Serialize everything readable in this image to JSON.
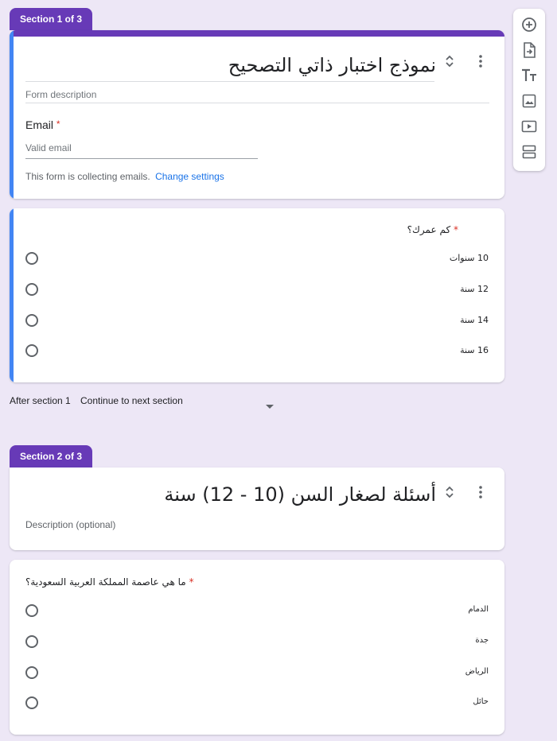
{
  "sections": [
    {
      "tab_label": "Section 1 of 3",
      "title": "نموذج اختبار ذاتي التصحيح",
      "description_placeholder": "Form description",
      "email": {
        "label": "Email",
        "required_mark": "*",
        "placeholder": "Valid email",
        "collecting_note": "This form is collecting emails.",
        "change_settings": "Change settings"
      },
      "question": {
        "text": "كم عمرك؟",
        "required_mark": "*",
        "options": [
          "10 سنوات",
          "12 سنة",
          "14 سنة",
          "16 سنة"
        ]
      },
      "after_section": {
        "label": "After section 1",
        "value": "Continue to next section"
      }
    },
    {
      "tab_label": "Section 2 of 3",
      "title": "أسئلة لصغار السن (10 - 12) سنة",
      "description_placeholder": "Description (optional)",
      "question": {
        "text": "ما هي عاصمة المملكة العربية السعودية؟",
        "required_mark": "*",
        "options": [
          "الدمام",
          "جدة",
          "الرياض",
          "حائل"
        ]
      }
    }
  ],
  "toolbar": {
    "tools": [
      "add-question-icon",
      "import-questions-icon",
      "add-title-icon",
      "add-image-icon",
      "add-video-icon",
      "add-section-icon"
    ]
  },
  "colors": {
    "accent": "#673ab7",
    "focus_bar": "#4285f4",
    "link": "#1a73e8",
    "required": "#d93025"
  }
}
